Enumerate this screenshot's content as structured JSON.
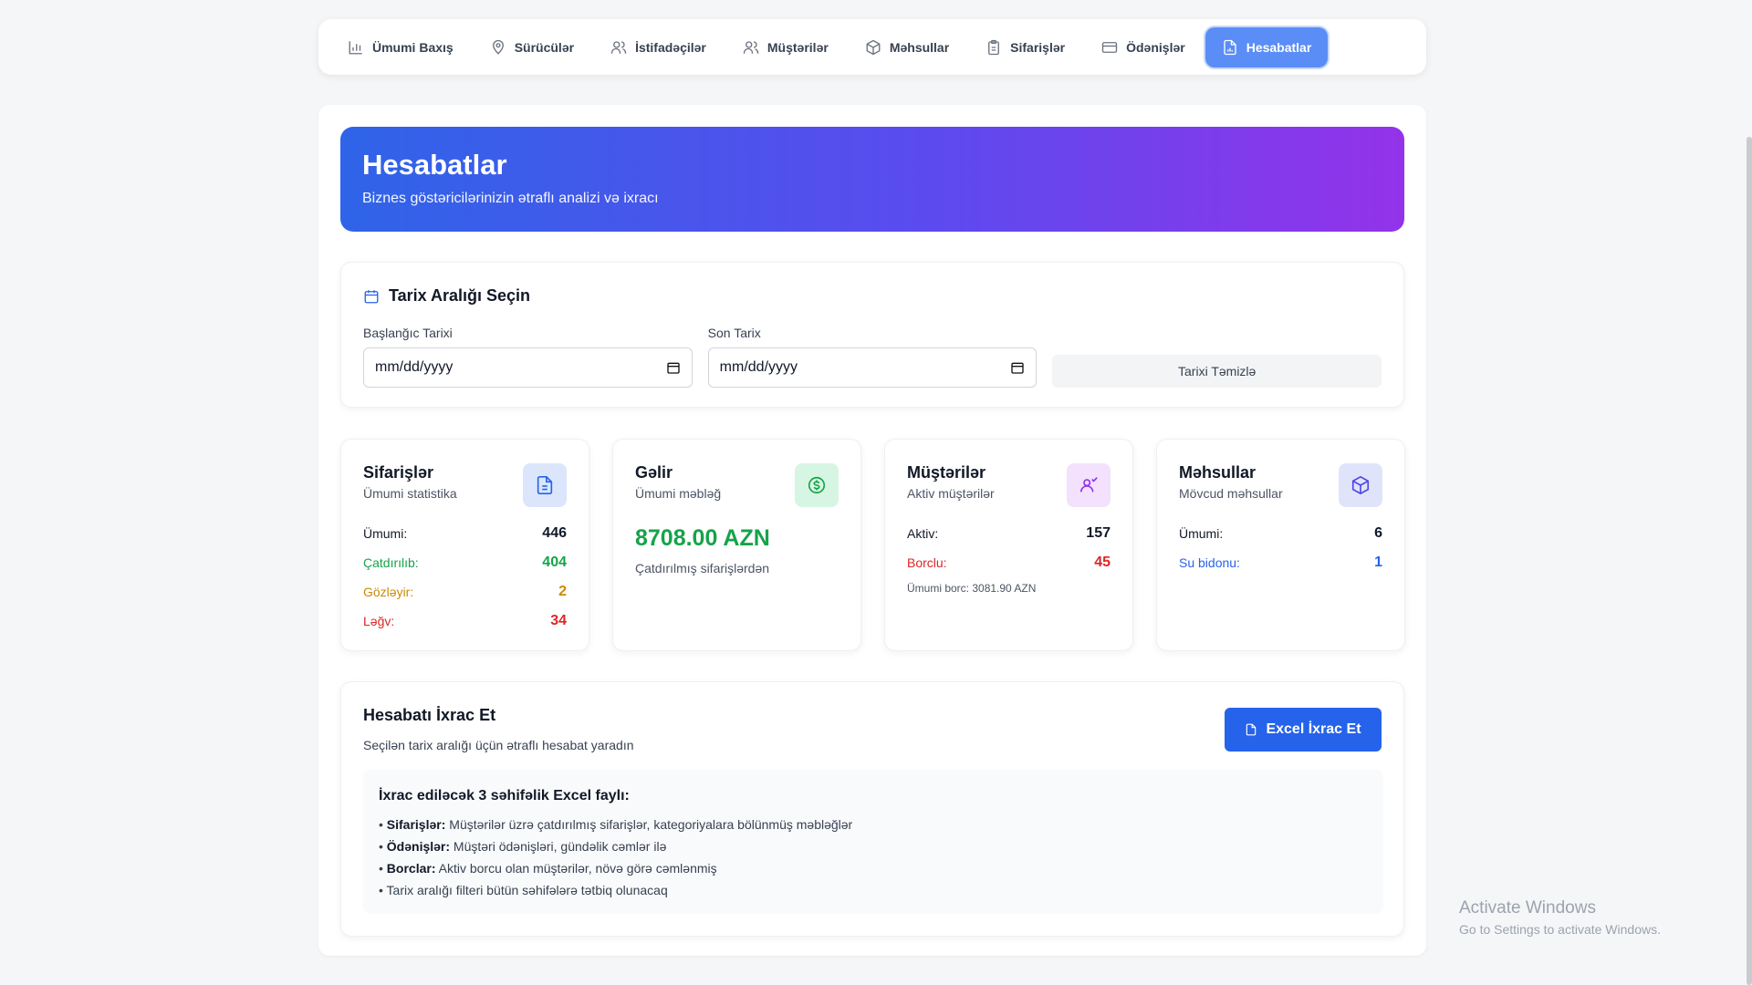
{
  "nav": {
    "items": [
      {
        "label": "Ümumi Baxış",
        "icon": "bar-chart-icon"
      },
      {
        "label": "Sürücülər",
        "icon": "map-pin-icon"
      },
      {
        "label": "İstifadəçilər",
        "icon": "users-icon"
      },
      {
        "label": "Müştərilər",
        "icon": "users-icon"
      },
      {
        "label": "Məhsullar",
        "icon": "package-icon"
      },
      {
        "label": "Sifarişlər",
        "icon": "clipboard-icon"
      },
      {
        "label": "Ödənişlər",
        "icon": "credit-card-icon"
      },
      {
        "label": "Hesabatlar",
        "icon": "file-chart-icon",
        "active": true
      }
    ]
  },
  "hero": {
    "title": "Hesabatlar",
    "subtitle": "Biznes göstəricilərinizin ətraflı analizi və ixracı"
  },
  "date_range": {
    "title": "Tarix Aralığı Seçin",
    "start_label": "Başlanğıc Tarixi",
    "start_value": "mm/dd/yyyy",
    "end_label": "Son Tarix",
    "end_value": "mm/dd/yyyy",
    "clear_label": "Tarixi Təmizlə"
  },
  "stats": {
    "orders": {
      "title": "Sifarişlər",
      "subtitle": "Ümumi statistika",
      "total_label": "Ümumi:",
      "total": "446",
      "delivered_label": "Çatdırılıb:",
      "delivered": "404",
      "pending_label": "Gözləyir:",
      "pending": "2",
      "cancelled_label": "Ləğv:",
      "cancelled": "34"
    },
    "revenue": {
      "title": "Gəlir",
      "subtitle": "Ümumi məbləğ",
      "amount": "8708.00 AZN",
      "note": "Çatdırılmış sifarişlərdən"
    },
    "customers": {
      "title": "Müştərilər",
      "subtitle": "Aktiv müştərilər",
      "active_label": "Aktiv:",
      "active": "157",
      "debtor_label": "Borclu:",
      "debtor": "45",
      "debt_note": "Ümumi borc: 3081.90 AZN"
    },
    "products": {
      "title": "Məhsullar",
      "subtitle": "Mövcud məhsullar",
      "total_label": "Ümumi:",
      "total": "6",
      "water_label": "Su bidonu:",
      "water": "1"
    }
  },
  "export": {
    "title": "Hesabatı İxrac Et",
    "subtitle": "Seçilən tarix aralığı üçün ətraflı hesabat yaradın",
    "button_label": "Excel İxrac Et",
    "info_title": "İxrac ediləcək 3 səhifəlik Excel faylı:",
    "items": [
      {
        "bold": "Sifarişlər:",
        "text": " Müştərilər üzrə çatdırılmış sifarişlər, kategoriyalara bölünmüş məbləğlər"
      },
      {
        "bold": "Ödənişlər:",
        "text": " Müştəri ödənişləri, gündəlik cəmlər ilə"
      },
      {
        "bold": "Borclar:",
        "text": " Aktiv borcu olan müştərilər, növə görə cəmlənmiş"
      },
      {
        "bold": "",
        "text": "Tarix aralığı filteri bütün səhifələrə tətbiq olunacaq"
      }
    ]
  },
  "watermark": {
    "line1": "Activate Windows",
    "line2": "Go to Settings to activate Windows."
  },
  "colors": {
    "accent": "#2563eb",
    "green": "#16a34a",
    "amber": "#ca8a04",
    "red": "#dc2626",
    "purple": "#9333ea"
  }
}
